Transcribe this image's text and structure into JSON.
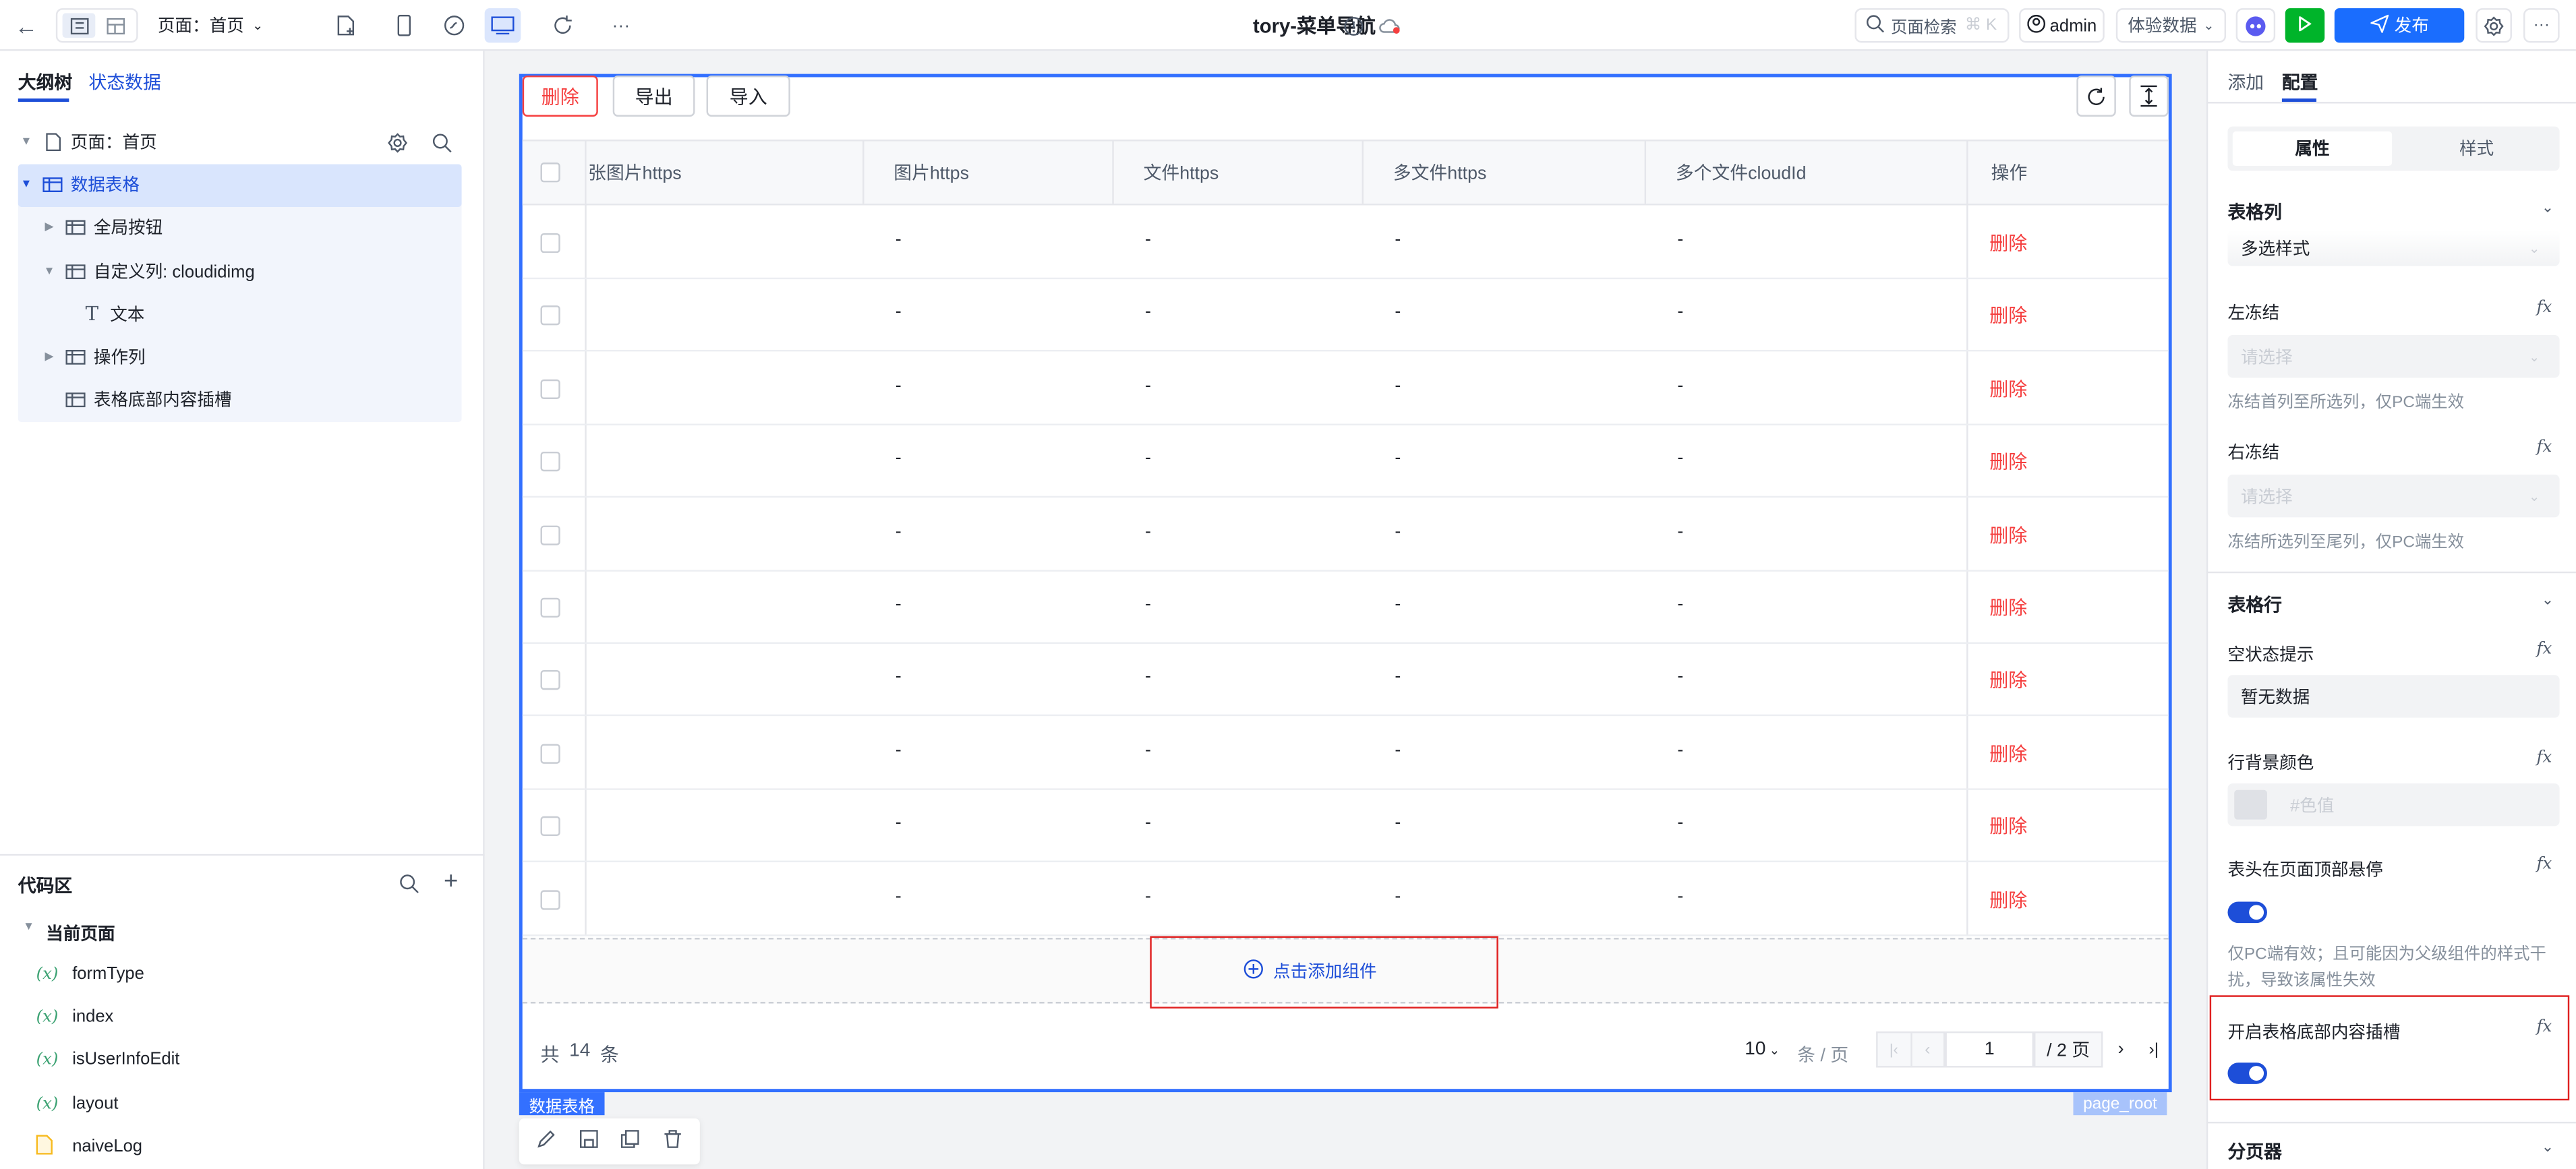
{
  "topbar": {
    "page_label": "页面：首页",
    "app_title": "tory-菜单导航",
    "search_label": "页面检索",
    "search_shortcut": "⌘ K",
    "user": "admin",
    "env": "体验数据",
    "publish": "发布",
    "more": "···"
  },
  "left": {
    "tab_outline": "大纲树",
    "tab_state": "状态数据",
    "tree": [
      {
        "label": "页面：首页"
      },
      {
        "label": "数据表格"
      },
      {
        "label": "全局按钮"
      },
      {
        "label": "自定义列: cloudidimg"
      },
      {
        "label": "文本"
      },
      {
        "label": "操作列"
      },
      {
        "label": "表格底部内容插槽"
      }
    ],
    "code_title": "代码区",
    "code_group": "当前页面",
    "code_items": [
      {
        "label": "formType"
      },
      {
        "label": "index"
      },
      {
        "label": "isUserInfoEdit"
      },
      {
        "label": "layout"
      },
      {
        "label": "naiveLog"
      }
    ]
  },
  "table": {
    "buttons": {
      "delete": "删除",
      "export": "导出",
      "import": "导入"
    },
    "columns": [
      "张图片https",
      "图片https",
      "文件https",
      "多文件https",
      "多个文件cloudId",
      "操作"
    ],
    "cell_empty": "-",
    "row_action": "删除",
    "add_component": "点击添加组件",
    "total_prefix": "共",
    "total": "14",
    "total_suffix": "条",
    "page_size": "10",
    "page_size_unit": "条 / 页",
    "current_page": "1",
    "total_pages": "/ 2 页",
    "badge": "数据表格",
    "root_badge": "page_root"
  },
  "right": {
    "tab_add": "添加",
    "tab_config": "配置",
    "seg_props": "属性",
    "seg_style": "样式",
    "sec_column": "表格列",
    "select_style": "多选样式",
    "left_freeze": "左冻结",
    "left_freeze_placeholder": "请选择",
    "left_freeze_hint": "冻结首列至所选列，仅PC端生效",
    "right_freeze": "右冻结",
    "right_freeze_placeholder": "请选择",
    "right_freeze_hint": "冻结所选列至尾列，仅PC端生效",
    "sec_row": "表格行",
    "empty_tip_label": "空状态提示",
    "empty_tip_value": "暂无数据",
    "row_bg_label": "行背景颜色",
    "row_bg_placeholder": "#色值",
    "sticky_label": "表头在页面顶部悬停",
    "sticky_hint_1": "仅PC端有效；且可能因为父级组件的样式干",
    "sticky_hint_2": "扰，导致该属性失效",
    "slot_label": "开启表格底部内容插槽",
    "sec_pager": "分页器",
    "fx": "fx"
  },
  "colors": {
    "primary": "#1d4ed8",
    "danger": "#f53f3f",
    "publish": "#1a6dfe",
    "run": "#00b42a"
  }
}
